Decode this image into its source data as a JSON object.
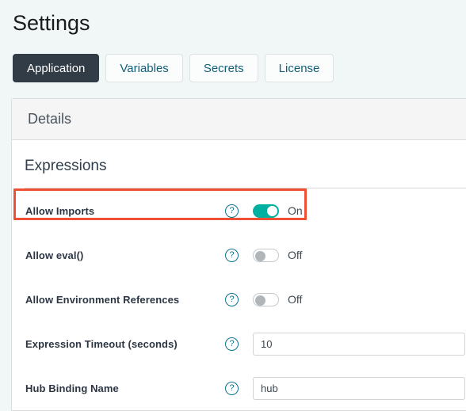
{
  "page": {
    "title": "Settings"
  },
  "tabs": [
    {
      "label": "Application",
      "active": true
    },
    {
      "label": "Variables",
      "active": false
    },
    {
      "label": "Secrets",
      "active": false
    },
    {
      "label": "License",
      "active": false
    }
  ],
  "card": {
    "header_title": "Details",
    "section_title": "Expressions"
  },
  "icons": {
    "help": "?",
    "help_name": "help-icon"
  },
  "rows": [
    {
      "label": "Allow Imports",
      "control": "toggle",
      "state": "on",
      "state_label": "On",
      "highlighted": true
    },
    {
      "label": "Allow eval()",
      "control": "toggle",
      "state": "off",
      "state_label": "Off",
      "highlighted": false
    },
    {
      "label": "Allow Environment References",
      "control": "toggle",
      "state": "off",
      "state_label": "Off",
      "highlighted": false
    },
    {
      "label": "Expression Timeout (seconds)",
      "control": "input",
      "value": "10",
      "placeholder": "",
      "highlighted": false
    },
    {
      "label": "Hub Binding Name",
      "control": "input",
      "value": "hub",
      "placeholder": "",
      "highlighted": false
    }
  ],
  "colors": {
    "page_background": "#f1f6f6",
    "active_tab_background": "#323c46",
    "tab_text": "#11607a",
    "toggle_on": "#00b0a0",
    "help_icon": "#0e7490",
    "highlight_border": "#ef5034",
    "label_text": "#2c3643"
  }
}
